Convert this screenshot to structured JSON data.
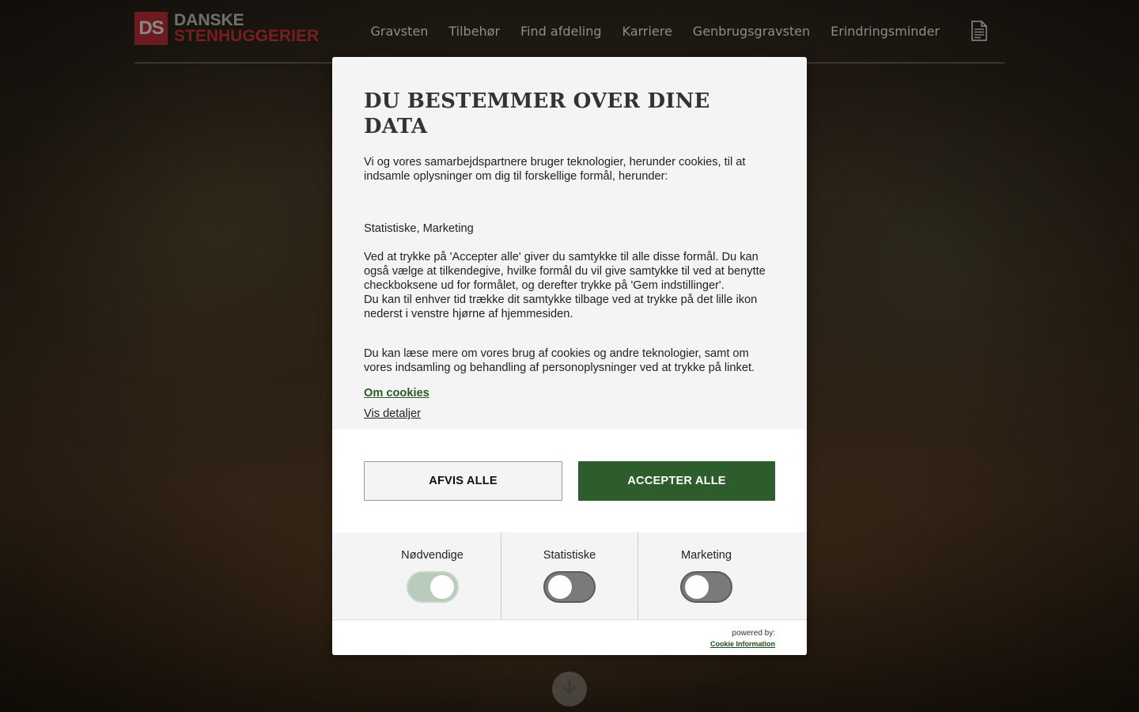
{
  "site": {
    "logo": {
      "mark": "DS",
      "line1": "DANSKE",
      "line2": "STENHUGGERIER"
    },
    "nav": [
      "Gravsten",
      "Tilbehør",
      "Find afdeling",
      "Karriere",
      "Genbrugsgravsten",
      "Erindringsminder"
    ],
    "icons": {
      "document": "document-icon",
      "scroll_down": "arrow-down-icon"
    }
  },
  "dialog": {
    "title": "DU BESTEMMER OVER DINE DATA",
    "intro": "Vi og vores samarbejdspartnere bruger teknologier, herunder cookies, til at indsamle oplysninger om dig til forskellige formål, herunder:",
    "purposes": "Statistiske, Marketing",
    "consent_1": "Ved at trykke på 'Accepter alle' giver du samtykke til alle disse formål. Du kan også vælge at tilkendegive, hvilke formål du vil give samtykke til ved at benytte checkboksene ud for formålet, og derefter trykke på 'Gem indstillinger'.",
    "consent_2": "Du kan til enhver tid trække dit samtykke tilbage ved at trykke på det lille ikon nederst i venstre hjørne af hjemmesiden.",
    "more_info": "Du kan læse mere om vores brug af cookies og andre teknologier, samt om vores indsamling og behandling af personoplysninger ved at trykke på linket.",
    "link_cookies": "Om cookies",
    "link_details": "Vis detaljer",
    "decline_label": "AFVIS ALLE",
    "accept_label": "ACCEPTER ALLE",
    "toggles": [
      {
        "label": "Nødvendige",
        "on": true
      },
      {
        "label": "Statistiske",
        "on": false
      },
      {
        "label": "Marketing",
        "on": false
      }
    ],
    "powered_by": "powered by:",
    "provider": "Cookie Information"
  },
  "colors": {
    "accent_green": "#2d5c2d",
    "brand_red": "#b3232c"
  }
}
